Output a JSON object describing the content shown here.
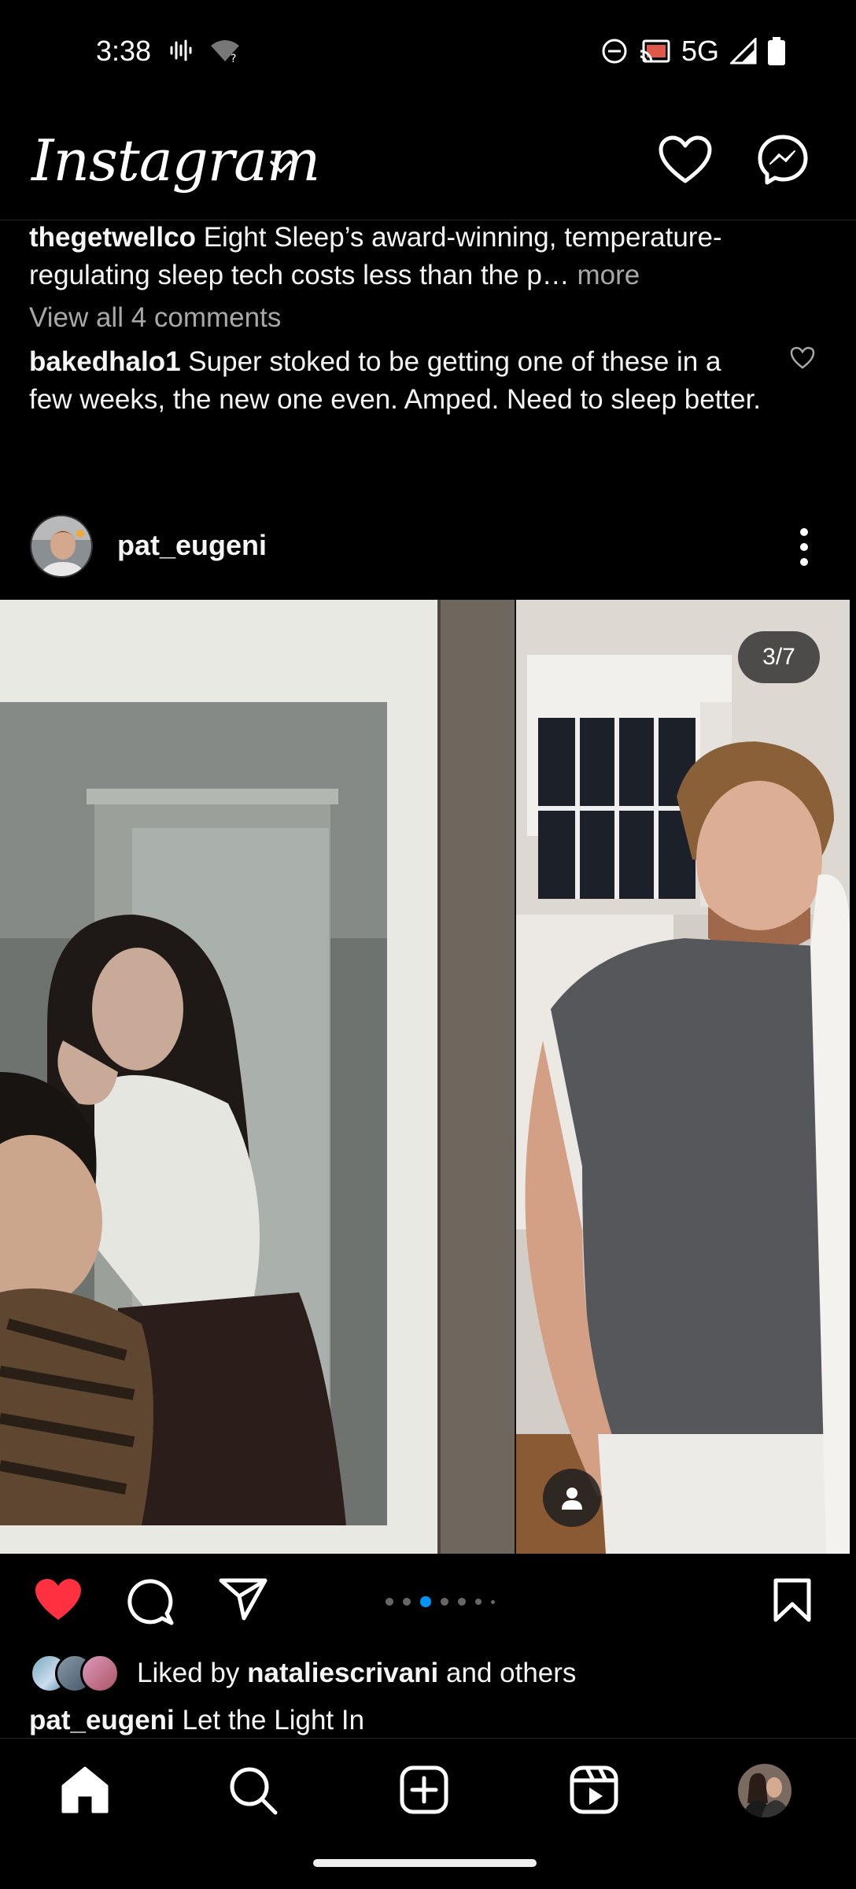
{
  "status_bar": {
    "time": "3:38",
    "network": "5G",
    "icons": [
      "voicemail-icon",
      "wifi-unknown-icon",
      "do-not-disturb-icon",
      "cast-icon",
      "signal-icon",
      "battery-icon"
    ]
  },
  "header": {
    "logo": "Instagram",
    "icons": [
      "chevron-down-icon",
      "heart-icon",
      "messenger-icon"
    ]
  },
  "prev_post": {
    "caption_user": "thegetwellco",
    "caption_text": " Eight Sleep’s award-winning, temperature-regulating sleep tech costs less than the p…",
    "more_label": " more",
    "view_comments": "View all 4 comments",
    "comment_user": "bakedhalo1",
    "comment_text": " Super stoked to be getting one of these in a few weeks, the new one even.  Amped.  Need to sleep better."
  },
  "post": {
    "username": "pat_eugeni",
    "media_counter": "3/7",
    "carousel_active_index": 2,
    "carousel_total_dots": 7,
    "liked_by_prefix": "Liked by ",
    "liked_by_user": "nataliescrivani",
    "liked_by_suffix": " and others",
    "caption_user": "pat_eugeni",
    "caption_text": " Let the Light In",
    "liked": true
  },
  "colors": {
    "background": "#000000",
    "like_red": "#ff3040",
    "carousel_active": "#0095f6",
    "secondary_text": "#a8a8a8"
  },
  "bottom_nav": [
    "home-icon",
    "search-icon",
    "create-icon",
    "reels-icon",
    "profile-avatar"
  ]
}
